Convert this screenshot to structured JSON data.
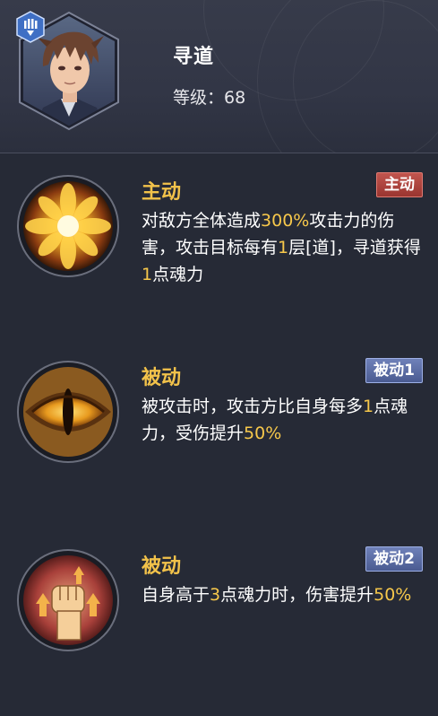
{
  "hero": {
    "name": "寻道",
    "level_label": "等级：",
    "level_value": "68"
  },
  "skills": [
    {
      "title": "主动",
      "tag": "主动",
      "tag_kind": "active",
      "icon": "golden-burst-icon",
      "desc": [
        {
          "t": "对敌方全体造成"
        },
        {
          "t": "300%",
          "hl": true
        },
        {
          "t": "攻击力的伤害，攻击目标每有"
        },
        {
          "t": "1",
          "hl": true
        },
        {
          "t": "层[道]，寻道获得"
        },
        {
          "t": "1",
          "hl": true
        },
        {
          "t": "点魂力"
        }
      ]
    },
    {
      "title": "被动",
      "tag": "被动1",
      "tag_kind": "passive",
      "icon": "dragon-eye-icon",
      "desc": [
        {
          "t": "被攻击时，攻击方比自身每多"
        },
        {
          "t": "1",
          "hl": true
        },
        {
          "t": "点魂力，受伤提升"
        },
        {
          "t": "50%",
          "hl": true
        }
      ]
    },
    {
      "title": "被动",
      "tag": "被动2",
      "tag_kind": "passive",
      "icon": "raised-fist-icon",
      "desc": [
        {
          "t": "自身高于"
        },
        {
          "t": "3",
          "hl": true
        },
        {
          "t": "点魂力时，伤害提升"
        },
        {
          "t": "50%",
          "hl": true
        }
      ]
    }
  ],
  "colors": {
    "highlight": "#f7c84b",
    "title": "#f2c24a",
    "background": "#262a36"
  }
}
